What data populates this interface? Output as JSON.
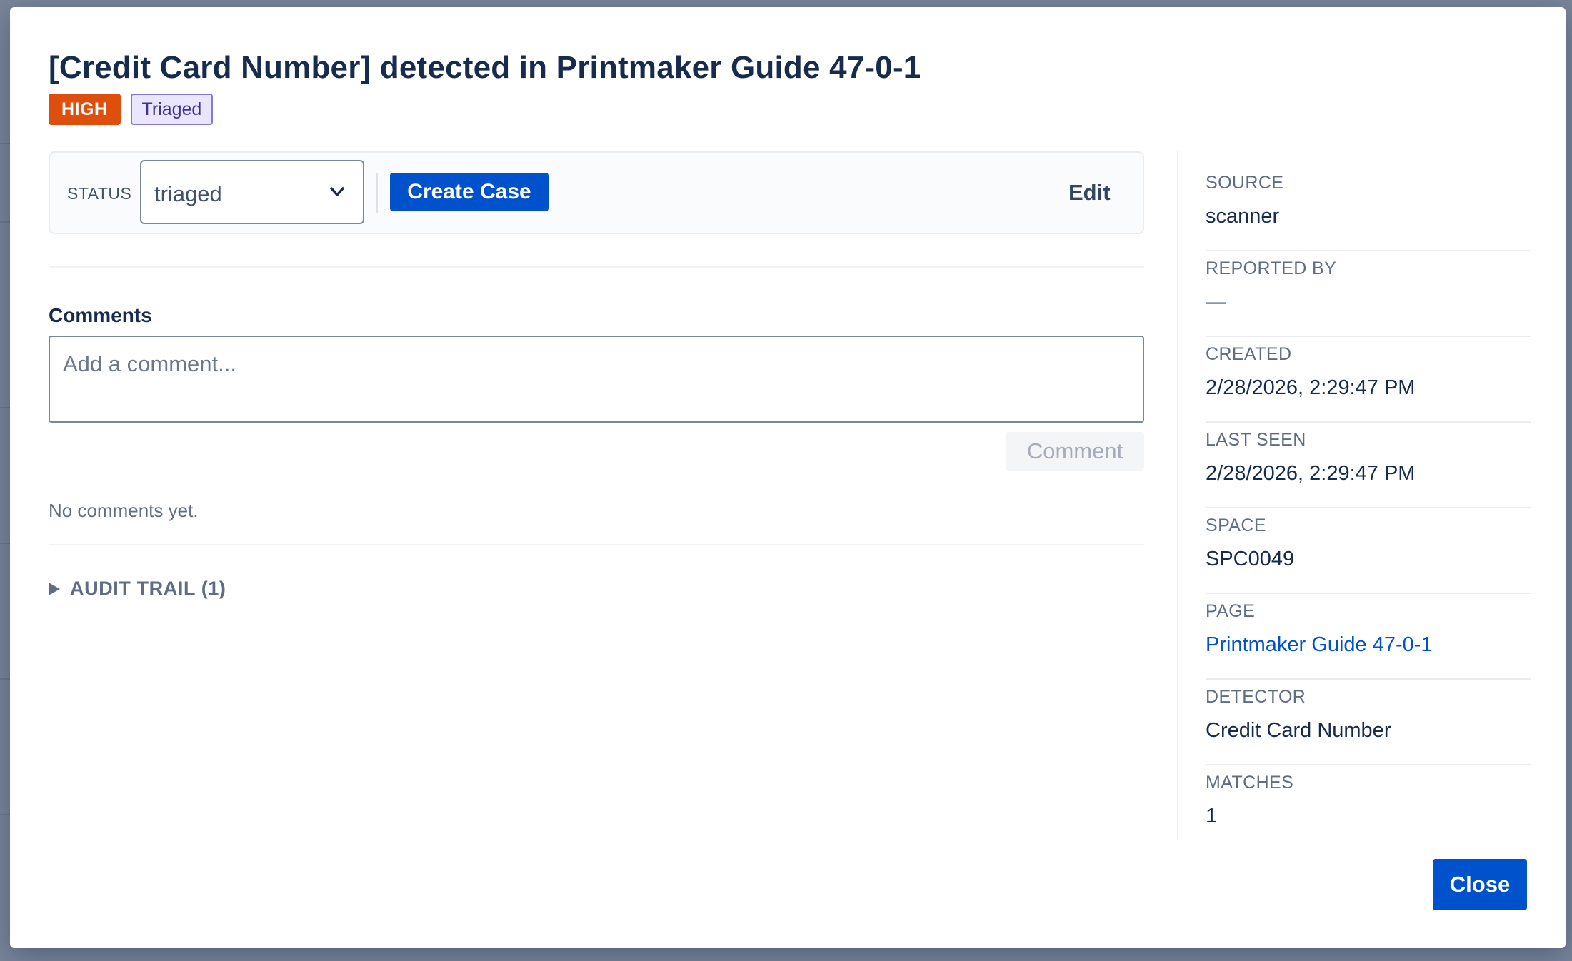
{
  "modal": {
    "title": "[Credit Card Number] detected in Printmaker Guide 47-0-1",
    "severity": "HIGH",
    "state_badge": "Triaged"
  },
  "toolbar": {
    "status_label": "STATUS",
    "status_value": "triaged",
    "create_case_label": "Create Case",
    "edit_label": "Edit"
  },
  "comments": {
    "heading": "Comments",
    "placeholder": "Add a comment...",
    "submit_label": "Comment",
    "empty_text": "No comments yet."
  },
  "audit": {
    "label": "AUDIT TRAIL (1)"
  },
  "details": [
    {
      "label": "SOURCE",
      "value": "scanner"
    },
    {
      "label": "REPORTED BY",
      "value": "—"
    },
    {
      "label": "CREATED",
      "value": "2/28/2026, 2:29:47 PM"
    },
    {
      "label": "LAST SEEN",
      "value": "2/28/2026, 2:29:47 PM"
    },
    {
      "label": "SPACE",
      "value": "SPC0049"
    },
    {
      "label": "PAGE",
      "value": "Printmaker Guide 47-0-1"
    },
    {
      "label": "DETECTOR",
      "value": "Credit Card Number"
    },
    {
      "label": "MATCHES",
      "value": "1"
    }
  ],
  "footer": {
    "close_label": "Close"
  },
  "colors": {
    "primary": "#0052cc",
    "severity_high": "#de4e0c",
    "triaged_bg": "#eae6ff",
    "triaged_text": "#403294",
    "overlay": "rgba(9, 30, 66, 0.54)"
  },
  "icons": {
    "status_dropdown": "chevron-down-icon",
    "audit_toggle": "triangle-right-icon"
  }
}
